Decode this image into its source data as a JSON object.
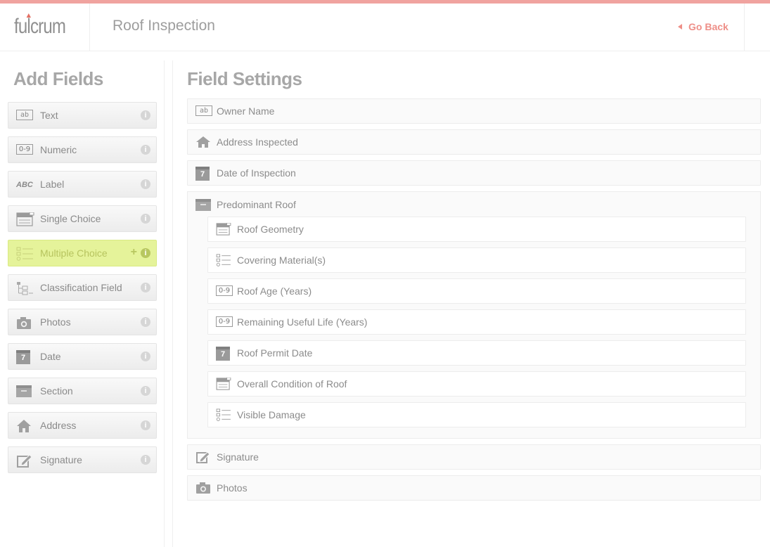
{
  "header": {
    "logo": "fulcrum",
    "title": "Roof Inspection",
    "go_back": "Go Back"
  },
  "add_fields": {
    "title": "Add Fields",
    "items": [
      {
        "label": "Text",
        "icon": "text-field-icon"
      },
      {
        "label": "Numeric",
        "icon": "numeric-field-icon"
      },
      {
        "label": "Label",
        "icon": "label-field-icon"
      },
      {
        "label": "Single Choice",
        "icon": "single-choice-icon"
      },
      {
        "label": "Multiple Choice",
        "icon": "multiple-choice-icon",
        "active": true
      },
      {
        "label": "Classification Field",
        "icon": "classification-icon"
      },
      {
        "label": "Photos",
        "icon": "camera-icon"
      },
      {
        "label": "Date",
        "icon": "calendar-icon"
      },
      {
        "label": "Section",
        "icon": "section-box-icon"
      },
      {
        "label": "Address",
        "icon": "house-icon"
      },
      {
        "label": "Signature",
        "icon": "signature-icon"
      }
    ],
    "info_glyph": "i",
    "plus_glyph": "+",
    "icon_text": {
      "ab": "ab",
      "num": "0-9",
      "abc": "ABC",
      "cal": "7"
    }
  },
  "field_settings": {
    "title": "Field Settings",
    "fields": [
      {
        "label": "Owner Name",
        "icon": "text-field-icon"
      },
      {
        "label": "Address Inspected",
        "icon": "house-icon"
      },
      {
        "label": "Date of Inspection",
        "icon": "calendar-icon"
      },
      {
        "label": "Predominant Roof",
        "icon": "section-box-icon"
      },
      {
        "label": "Signature",
        "icon": "signature-icon"
      },
      {
        "label": "Photos",
        "icon": "camera-icon"
      }
    ],
    "section_children": [
      {
        "label": "Roof Geometry",
        "icon": "single-choice-icon"
      },
      {
        "label": "Covering Material(s)",
        "icon": "multiple-choice-icon"
      },
      {
        "label": "Roof Age (Years)",
        "icon": "numeric-field-icon"
      },
      {
        "label": "Remaining Useful Life (Years)",
        "icon": "numeric-field-icon"
      },
      {
        "label": "Roof Permit Date",
        "icon": "calendar-icon"
      },
      {
        "label": "Overall Condition of Roof",
        "icon": "single-choice-icon"
      },
      {
        "label": "Visible Damage",
        "icon": "multiple-choice-icon"
      }
    ]
  },
  "colors": {
    "accent_bar": "#f0a39f",
    "go_back": "#ee8f88",
    "active_item": "#e5f39a"
  }
}
